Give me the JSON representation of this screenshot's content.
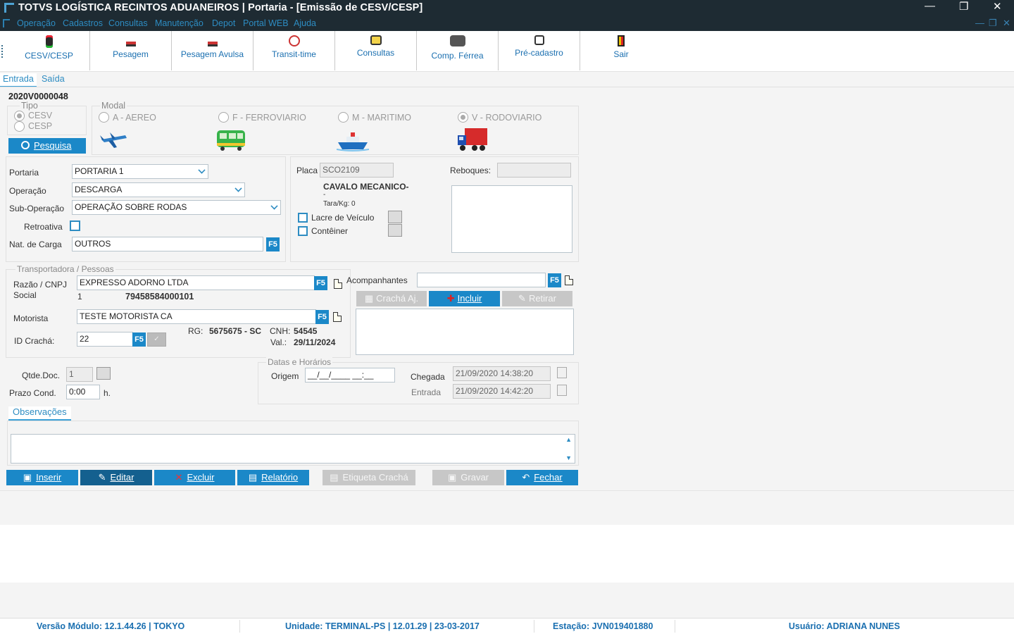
{
  "window": {
    "title": "TOTVS LOGÍSTICA RECINTOS ADUANEIROS | Portaria - [Emissão de CESV/CESP]",
    "controls": {
      "minimize": "—",
      "restore": "❐",
      "close": "✕"
    },
    "mdi_controls": {
      "minimize": "—",
      "restore": "❐",
      "close": "✕"
    }
  },
  "menu": [
    "Operação",
    "Cadastros",
    "Consultas",
    "Manutenção",
    "Depot",
    "Portal WEB",
    "Ajuda"
  ],
  "toolbar": [
    {
      "label": "CESV/CESP",
      "icon": "traffic-light-icon"
    },
    {
      "label": "Pesagem",
      "icon": "scale-icon"
    },
    {
      "label": "Pesagem Avulsa",
      "icon": "scale-icon"
    },
    {
      "label": "Transit-time",
      "icon": "clock-icon"
    },
    {
      "label": "Consultas",
      "icon": "printer-icon"
    },
    {
      "label": "Comp. Férrea",
      "icon": "train-icon"
    },
    {
      "label": "Pré-cadastro",
      "icon": "register-icon"
    },
    {
      "label": "Sair",
      "icon": "exit-door-icon"
    }
  ],
  "tabs": {
    "entrada": "Entrada",
    "saida": "Saída"
  },
  "form": {
    "doc_number": "2020V0000048",
    "tipo": {
      "legend": "Tipo",
      "cesv": "CESV",
      "cesp": "CESP"
    },
    "modal": {
      "legend": "Modal",
      "aereo": "A - AEREO",
      "ferroviario": "F - FERROVIARIO",
      "maritimo": "M - MARITIMO",
      "rodoviario": "V - RODOVIARIO"
    },
    "pesquisa": "Pesquisa",
    "portaria_label": "Portaria",
    "portaria_value": "PORTARIA 1",
    "operacao_label": "Operação",
    "operacao_value": "DESCARGA",
    "suboperacao_label": "Sub-Operação",
    "suboperacao_value": "OPERAÇÃO SOBRE RODAS",
    "retroativa_label": "Retroativa",
    "natcarga_label": "Nat. de Carga",
    "natcarga_value": "OUTROS",
    "f5": "F5",
    "placa_label": "Placa",
    "placa_value": "SCO2109",
    "reboques_label": "Reboques:",
    "veiculo_tipo": "CAVALO MECANICO-",
    "veiculo_dash": "-",
    "tara": "Tara/Kg: 0",
    "lacre_label": "Lacre de Veículo",
    "conteiner_label": "Contêiner",
    "transportadora_legend": "Transportadora / Pessoas",
    "razao_label": "Razão / CNPJ Social",
    "razao_value": "EXPRESSO ADORNO LTDA",
    "razao_code": "1",
    "cnpj": "79458584000101",
    "acompanhantes_label": "Acompanhantes",
    "cracha_aj": "Crachá Aj.",
    "incluir": "Incluir",
    "retirar": "Retirar",
    "motorista_label": "Motorista",
    "motorista_value": "TESTE MOTORISTA CA",
    "idcracha_label": "ID Crachá:",
    "idcracha_value": "22",
    "rg_label": "RG:",
    "rg_value": "5675675 - SC",
    "cnh_label": "CNH:",
    "cnh_value": "54545",
    "val_label": "Val.:",
    "val_value": "29/11/2024",
    "qtde_label": "Qtde.Doc.",
    "qtde_value": "1",
    "prazo_label": "Prazo Cond.",
    "prazo_value": "0:00",
    "prazo_unit": "h.",
    "datas_legend": "Datas e Horários",
    "origem_label": "Origem",
    "origem_value": "__/__/____ __:__",
    "chegada_label": "Chegada",
    "chegada_value": "21/09/2020 14:38:20",
    "entrada_label": "Entrada",
    "entrada_value": "21/09/2020 14:42:20",
    "observacoes_label": "Observações"
  },
  "actions": {
    "inserir": "Inserir",
    "editar": "Editar",
    "excluir": "Excluir",
    "relatorio": "Relatório",
    "etiqueta": "Etiqueta Crachá",
    "gravar": "Gravar",
    "fechar": "Fechar"
  },
  "status": {
    "versao": "Versão Módulo:  12.1.44.26  |  TOKYO",
    "unidade": "Unidade: TERMINAL-PS | 12.01.29 | 23-03-2017",
    "estacao": "Estação: JVN019401880",
    "usuario": "Usuário: ADRIANA NUNES"
  }
}
